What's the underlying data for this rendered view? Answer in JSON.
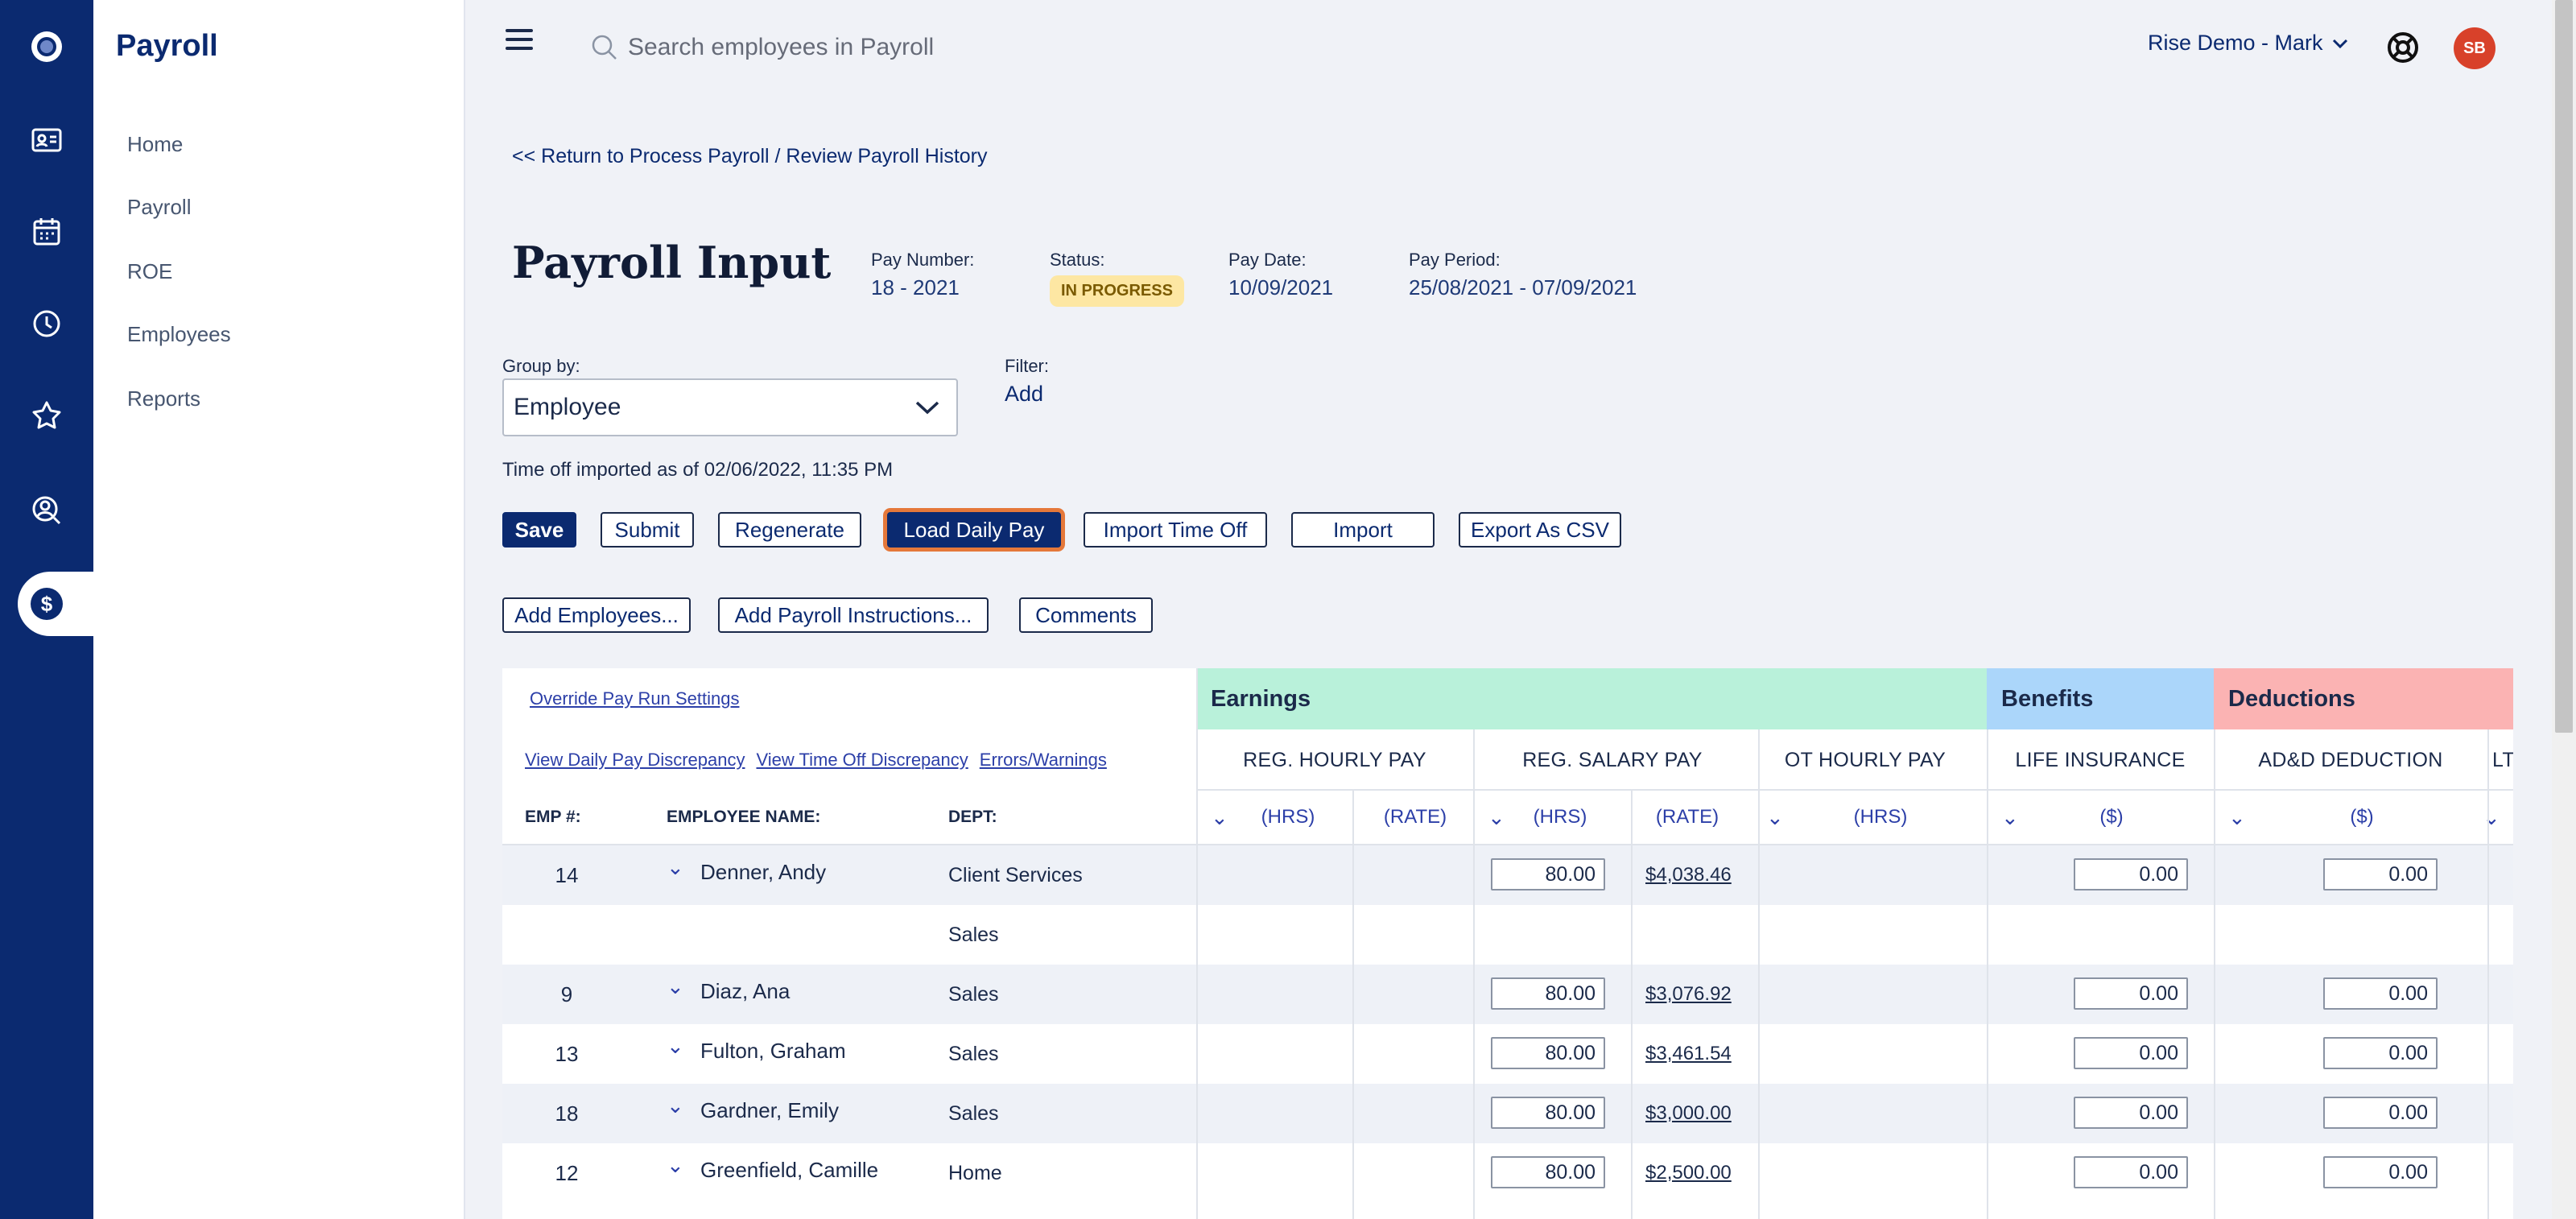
{
  "nav": {
    "app_title": "Payroll",
    "items": [
      {
        "label": "Home"
      },
      {
        "label": "Payroll"
      },
      {
        "label": "ROE"
      },
      {
        "label": "Employees"
      },
      {
        "label": "Reports"
      }
    ]
  },
  "rail": {
    "icons": [
      "logo-icon",
      "id-card-icon",
      "calendar-icon",
      "clock-icon",
      "star-icon",
      "user-search-icon",
      "dollar-icon"
    ],
    "dollar_glyph": "$"
  },
  "topbar": {
    "search_placeholder": "Search employees in Payroll",
    "account": "Rise Demo - Mark",
    "avatar_initials": "SB"
  },
  "page": {
    "back_link": "<< Return to Process Payroll / Review Payroll History",
    "title": "Payroll Input",
    "pay_number_label": "Pay Number:",
    "pay_number": "18 - 2021",
    "status_label": "Status:",
    "status": "IN PROGRESS",
    "pay_date_label": "Pay Date:",
    "pay_date": "10/09/2021",
    "pay_period_label": "Pay Period:",
    "pay_period": "25/08/2021 - 07/09/2021",
    "group_by_label": "Group by:",
    "group_by_value": "Employee",
    "filter_label": "Filter:",
    "filter_add": "Add",
    "time_off_note": "Time off imported as of 02/06/2022, 11:35 PM"
  },
  "actions": {
    "save": "Save",
    "submit": "Submit",
    "regenerate": "Regenerate",
    "load_daily_pay": "Load Daily Pay",
    "import_time_off": "Import Time Off",
    "import": "Import",
    "export_csv": "Export As CSV",
    "add_employees": "Add Employees...",
    "add_payroll_instructions": "Add Payroll Instructions...",
    "comments": "Comments"
  },
  "table": {
    "override_link": "Override Pay Run Settings",
    "view_daily_link": "View Daily Pay Discrepancy",
    "view_timeoff_link": "View Time Off Discrepancy",
    "errors_link": "Errors/Warnings",
    "groups": {
      "earnings": "Earnings",
      "benefits": "Benefits",
      "deductions": "Deductions"
    },
    "columns": {
      "emp_no": "EMP #:",
      "employee_name": "EMPLOYEE NAME:",
      "dept": "DEPT:",
      "reg_hourly": "REG. HOURLY PAY",
      "reg_salary": "REG. SALARY PAY",
      "ot_hourly": "OT HOURLY PAY",
      "life_insurance": "LIFE INSURANCE",
      "add_deduction": "AD&D DEDUCTION",
      "lt": "LT"
    },
    "subheaders": {
      "hrs": "(HRS)",
      "rate": "(RATE)",
      "dollar": "($)"
    },
    "rows": [
      {
        "emp": "14",
        "name": "Denner, Andy",
        "dept": "Client Services",
        "hrs": "80.00",
        "amount": "$4,038.46",
        "life": "0.00",
        "add": "0.00"
      },
      {
        "emp": "",
        "name": "",
        "dept": "Sales",
        "hrs": "",
        "amount": "",
        "life": "",
        "add": ""
      },
      {
        "emp": "9",
        "name": "Diaz, Ana",
        "dept": "Sales",
        "hrs": "80.00",
        "amount": "$3,076.92",
        "life": "0.00",
        "add": "0.00"
      },
      {
        "emp": "13",
        "name": "Fulton, Graham",
        "dept": "Sales",
        "hrs": "80.00",
        "amount": "$3,461.54",
        "life": "0.00",
        "add": "0.00"
      },
      {
        "emp": "18",
        "name": "Gardner, Emily",
        "dept": "Sales",
        "hrs": "80.00",
        "amount": "$3,000.00",
        "life": "0.00",
        "add": "0.00"
      },
      {
        "emp": "12",
        "name": "Greenfield, Camille",
        "dept": "Home",
        "hrs": "80.00",
        "amount": "$2,500.00",
        "life": "0.00",
        "add": "0.00"
      }
    ]
  }
}
